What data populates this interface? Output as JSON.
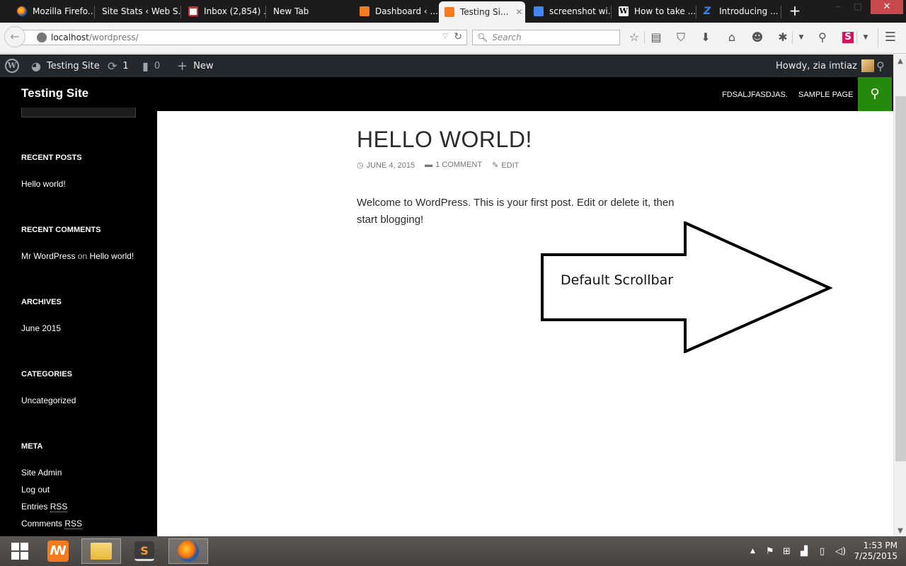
{
  "browser": {
    "tabs": [
      {
        "label": "Mozilla Firefo...",
        "icon": "firefox-icon",
        "active": false
      },
      {
        "label": "Site Stats ‹ Web S...",
        "icon": "none",
        "active": false
      },
      {
        "label": "Inbox (2,854) ...",
        "icon": "gmail-icon",
        "active": false
      },
      {
        "label": "New Tab",
        "icon": "none",
        "active": false
      },
      {
        "label": "Dashboard ‹ ...",
        "icon": "xampp-icon",
        "active": false
      },
      {
        "label": "Testing Si...",
        "icon": "xampp-icon",
        "active": true
      },
      {
        "label": "screenshot wi...",
        "icon": "google-icon",
        "active": false
      },
      {
        "label": "How to take ...",
        "icon": "wikihow-icon",
        "active": false
      },
      {
        "label": "Introducing ...",
        "icon": "z-icon",
        "active": false
      }
    ],
    "new_tab_glyph": "+",
    "close_tab_glyph": "✕",
    "window_close_glyph": "✕",
    "url_host": "localhost",
    "url_path": "/wordpress/",
    "search_placeholder": "Search",
    "toolbar_icons": [
      "bookmark-star-icon",
      "reading-list-icon",
      "pocket-icon",
      "download-icon",
      "home-icon",
      "chat-icon",
      "extension-icon",
      "pin-icon",
      "s-extension-icon",
      "menu-icon"
    ]
  },
  "adminbar": {
    "site_name": "Testing Site",
    "updates_count": "1",
    "comments_count": "0",
    "new_label": "New",
    "howdy": "Howdy, zia imtiaz"
  },
  "site": {
    "title": "Testing Site",
    "nav": [
      "FDSALJFASDJAS.",
      "SAMPLE PAGE"
    ],
    "accent_color": "#24890d"
  },
  "sidebar": {
    "widgets": [
      {
        "title": "RECENT POSTS",
        "items": [
          "Hello world!"
        ]
      },
      {
        "title": "RECENT COMMENTS",
        "comment_author": "Mr WordPress",
        "comment_on": "on",
        "comment_post": "Hello world!"
      },
      {
        "title": "ARCHIVES",
        "items": [
          "June 2015"
        ]
      },
      {
        "title": "CATEGORIES",
        "items": [
          "Uncategorized"
        ]
      },
      {
        "title": "META",
        "items": [
          "Site Admin",
          "Log out",
          "Entries",
          "Comments"
        ],
        "rss_label": "RSS"
      }
    ]
  },
  "post": {
    "title": "HELLO WORLD!",
    "date": "JUNE 4, 2015",
    "comments": "1 COMMENT",
    "edit": "EDIT",
    "body": "Welcome to WordPress. This is your first post. Edit or delete it, then start blogging!"
  },
  "annotation": {
    "label": "Default Scrollbar"
  },
  "taskbar": {
    "apps": [
      "start-button",
      "xampp",
      "file-explorer",
      "sublime-text",
      "firefox"
    ],
    "time": "1:53 PM",
    "date": "7/25/2015"
  }
}
